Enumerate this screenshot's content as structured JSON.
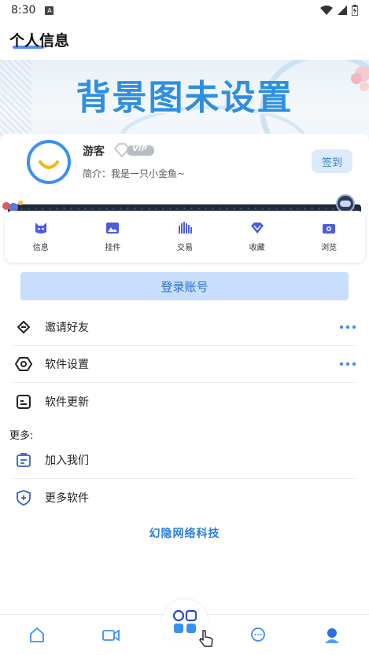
{
  "status_bar": {
    "time": "8:30",
    "app_icon": "A",
    "icons": [
      "wifi-icon",
      "signal-icon",
      "battery-icon"
    ]
  },
  "header": {
    "title": "个人信息"
  },
  "banner": {
    "text": "背景图未设置"
  },
  "profile": {
    "username": "游客",
    "vip_label": "VIP",
    "bio": "简介：我是一只小金鱼~",
    "signin_label": "签到"
  },
  "quick_menu": [
    {
      "label": "信息",
      "icon": "cat-icon"
    },
    {
      "label": "挂件",
      "icon": "image-icon"
    },
    {
      "label": "交易",
      "icon": "bars-icon"
    },
    {
      "label": "收藏",
      "icon": "diamond-icon"
    },
    {
      "label": "浏览",
      "icon": "camera-icon"
    }
  ],
  "login_label": "登录账号",
  "settings_list": [
    {
      "label": "邀请好友",
      "icon": "invite-icon",
      "has_more": true
    },
    {
      "label": "软件设置",
      "icon": "settings-hex-icon",
      "has_more": true
    },
    {
      "label": "软件更新",
      "icon": "update-icon",
      "has_more": false
    }
  ],
  "more_section": {
    "title": "更多:",
    "items": [
      {
        "label": "加入我们",
        "icon": "join-icon"
      },
      {
        "label": "更多软件",
        "icon": "shield-plus-icon"
      }
    ]
  },
  "footer_brand": "幻隐网络科技",
  "bottom_nav": [
    "home-icon",
    "video-icon",
    "apps-icon",
    "chat-icon",
    "profile-icon"
  ],
  "colors": {
    "accent": "#3a8ff5",
    "login_bg": "#c8defa",
    "banner_text": "#2e8fe0"
  }
}
